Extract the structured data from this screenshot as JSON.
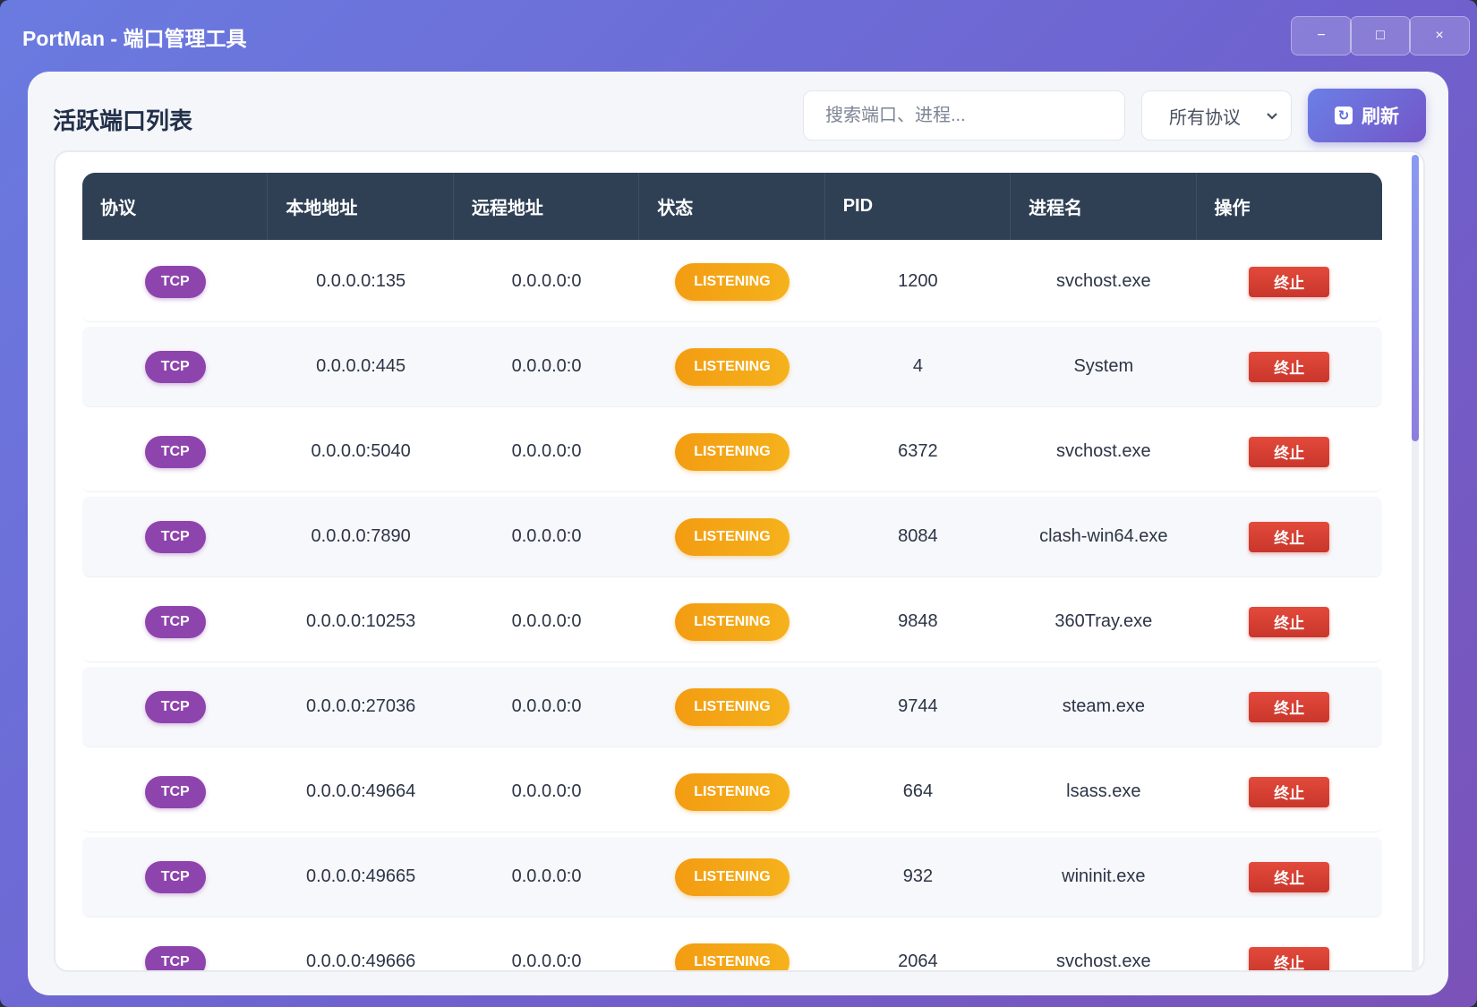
{
  "window": {
    "title": "PortMan - 端口管理工具",
    "controls": {
      "minimize": "−",
      "maximize": "□",
      "close": "×"
    }
  },
  "header": {
    "title": "活跃端口列表",
    "search_placeholder": "搜索端口、进程...",
    "protocol_filter": "所有协议",
    "refresh_label": "刷新"
  },
  "table": {
    "columns": [
      "协议",
      "本地地址",
      "远程地址",
      "状态",
      "PID",
      "进程名",
      "操作"
    ],
    "rows": [
      {
        "protocol": "TCP",
        "local": "0.0.0.0:135",
        "remote": "0.0.0.0:0",
        "state": "LISTENING",
        "pid": "1200",
        "process": "svchost.exe",
        "action": "终止"
      },
      {
        "protocol": "TCP",
        "local": "0.0.0.0:445",
        "remote": "0.0.0.0:0",
        "state": "LISTENING",
        "pid": "4",
        "process": "System",
        "action": "终止"
      },
      {
        "protocol": "TCP",
        "local": "0.0.0.0:5040",
        "remote": "0.0.0.0:0",
        "state": "LISTENING",
        "pid": "6372",
        "process": "svchost.exe",
        "action": "终止"
      },
      {
        "protocol": "TCP",
        "local": "0.0.0.0:7890",
        "remote": "0.0.0.0:0",
        "state": "LISTENING",
        "pid": "8084",
        "process": "clash-win64.exe",
        "action": "终止"
      },
      {
        "protocol": "TCP",
        "local": "0.0.0.0:10253",
        "remote": "0.0.0.0:0",
        "state": "LISTENING",
        "pid": "9848",
        "process": "360Tray.exe",
        "action": "终止"
      },
      {
        "protocol": "TCP",
        "local": "0.0.0.0:27036",
        "remote": "0.0.0.0:0",
        "state": "LISTENING",
        "pid": "9744",
        "process": "steam.exe",
        "action": "终止"
      },
      {
        "protocol": "TCP",
        "local": "0.0.0.0:49664",
        "remote": "0.0.0.0:0",
        "state": "LISTENING",
        "pid": "664",
        "process": "lsass.exe",
        "action": "终止"
      },
      {
        "protocol": "TCP",
        "local": "0.0.0.0:49665",
        "remote": "0.0.0.0:0",
        "state": "LISTENING",
        "pid": "932",
        "process": "wininit.exe",
        "action": "终止"
      },
      {
        "protocol": "TCP",
        "local": "0.0.0.0:49666",
        "remote": "0.0.0.0:0",
        "state": "LISTENING",
        "pid": "2064",
        "process": "svchost.exe",
        "action": "终止"
      }
    ]
  },
  "colors": {
    "accent": "#6b7fe6",
    "header_bg": "#2f4055",
    "protocol_badge": "#8e44ad",
    "state_badge": "#f39c12",
    "kill_button": "#e24a3b"
  }
}
